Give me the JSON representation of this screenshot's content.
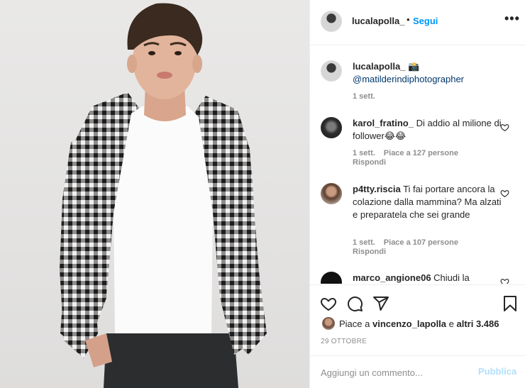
{
  "post": {
    "author": "lucalapolla_",
    "follow_label": "Segui",
    "separator": "•",
    "more_label": "•••"
  },
  "caption": {
    "user": "lucalapolla_",
    "emoji": "📸",
    "mention": "@matilderindiphotographer",
    "time": "1 sett."
  },
  "comments": [
    {
      "user": "karol_fratino_",
      "text": "Di addio al milione di follower😂😂",
      "time": "1 sett.",
      "likes": "Piace a 127 persone",
      "reply": "Rispondi"
    },
    {
      "user": "p4tty.riscia",
      "text": "Ti fai portare ancora la colazione dalla mammina? Ma alzati e preparatela che sei grande",
      "time": "1 sett.",
      "likes": "Piace a 107 persone",
      "reply": "Rispondi"
    },
    {
      "user": "marco_angione06",
      "text": "Chiudi la"
    }
  ],
  "likes": {
    "prefix": "Piace a ",
    "user": "vincenzo_lapolla",
    "suffix": " e ",
    "others": "altri 3.486"
  },
  "date": "29 OTTOBRE",
  "composer": {
    "placeholder": "Aggiungi un commento...",
    "publish_label": "Pubblica"
  },
  "colors": {
    "accent": "#0095f6",
    "publish_disabled": "#b2dffc",
    "muted": "#8e8e8e",
    "text": "#262626"
  },
  "icons": {
    "like": "heart-icon",
    "comment": "comment-icon",
    "share": "paper-plane-icon",
    "save": "bookmark-icon"
  }
}
